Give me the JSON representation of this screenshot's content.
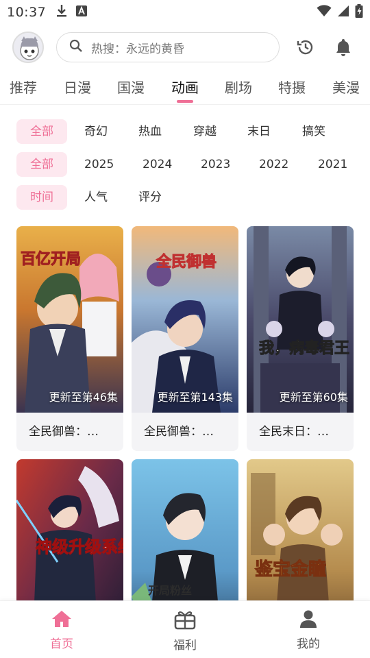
{
  "status_bar": {
    "time": "10:37",
    "icons": [
      "download-icon",
      "notification-a-icon",
      "wifi-icon",
      "signal-icon",
      "battery-charging-icon"
    ]
  },
  "header": {
    "avatar_icon": "avatar-icon",
    "search_placeholder": "热搜：永远的黄昏",
    "history_icon": "history-icon",
    "bell_icon": "bell-icon"
  },
  "tabs": {
    "items": [
      "推荐",
      "日漫",
      "国漫",
      "动画",
      "剧场",
      "特摄",
      "美漫"
    ],
    "active": "动画"
  },
  "filters": {
    "genre": [
      "全部",
      "奇幻",
      "热血",
      "穿越",
      "末日",
      "搞笑"
    ],
    "year": [
      "全部",
      "2025",
      "2024",
      "2023",
      "2022",
      "2021"
    ],
    "sort": [
      "时间",
      "人气",
      "评分"
    ]
  },
  "cards": [
    {
      "title": "全民御兽：…",
      "episode": "更新至第46集",
      "cover_text": "百亿开局"
    },
    {
      "title": "全民御兽：…",
      "episode": "更新至第143集",
      "cover_text": "全民御兽"
    },
    {
      "title": "全民末日：…",
      "episode": "更新至第60集",
      "cover_text": "我，病毒君王"
    },
    {
      "title": "",
      "episode": "",
      "cover_text": "神级升级系统"
    },
    {
      "title": "",
      "episode": "",
      "cover_text": "开局粉丝"
    },
    {
      "title": "",
      "episode": "",
      "cover_text": "鉴宝金瞳"
    }
  ],
  "bottom_nav": {
    "items": [
      {
        "label": "首页",
        "icon": "home-icon"
      },
      {
        "label": "福利",
        "icon": "gift-icon"
      },
      {
        "label": "我的",
        "icon": "person-icon"
      }
    ],
    "active": "首页"
  },
  "colors": {
    "accent": "#ef6f96",
    "chip_bg": "#fde8ef"
  }
}
